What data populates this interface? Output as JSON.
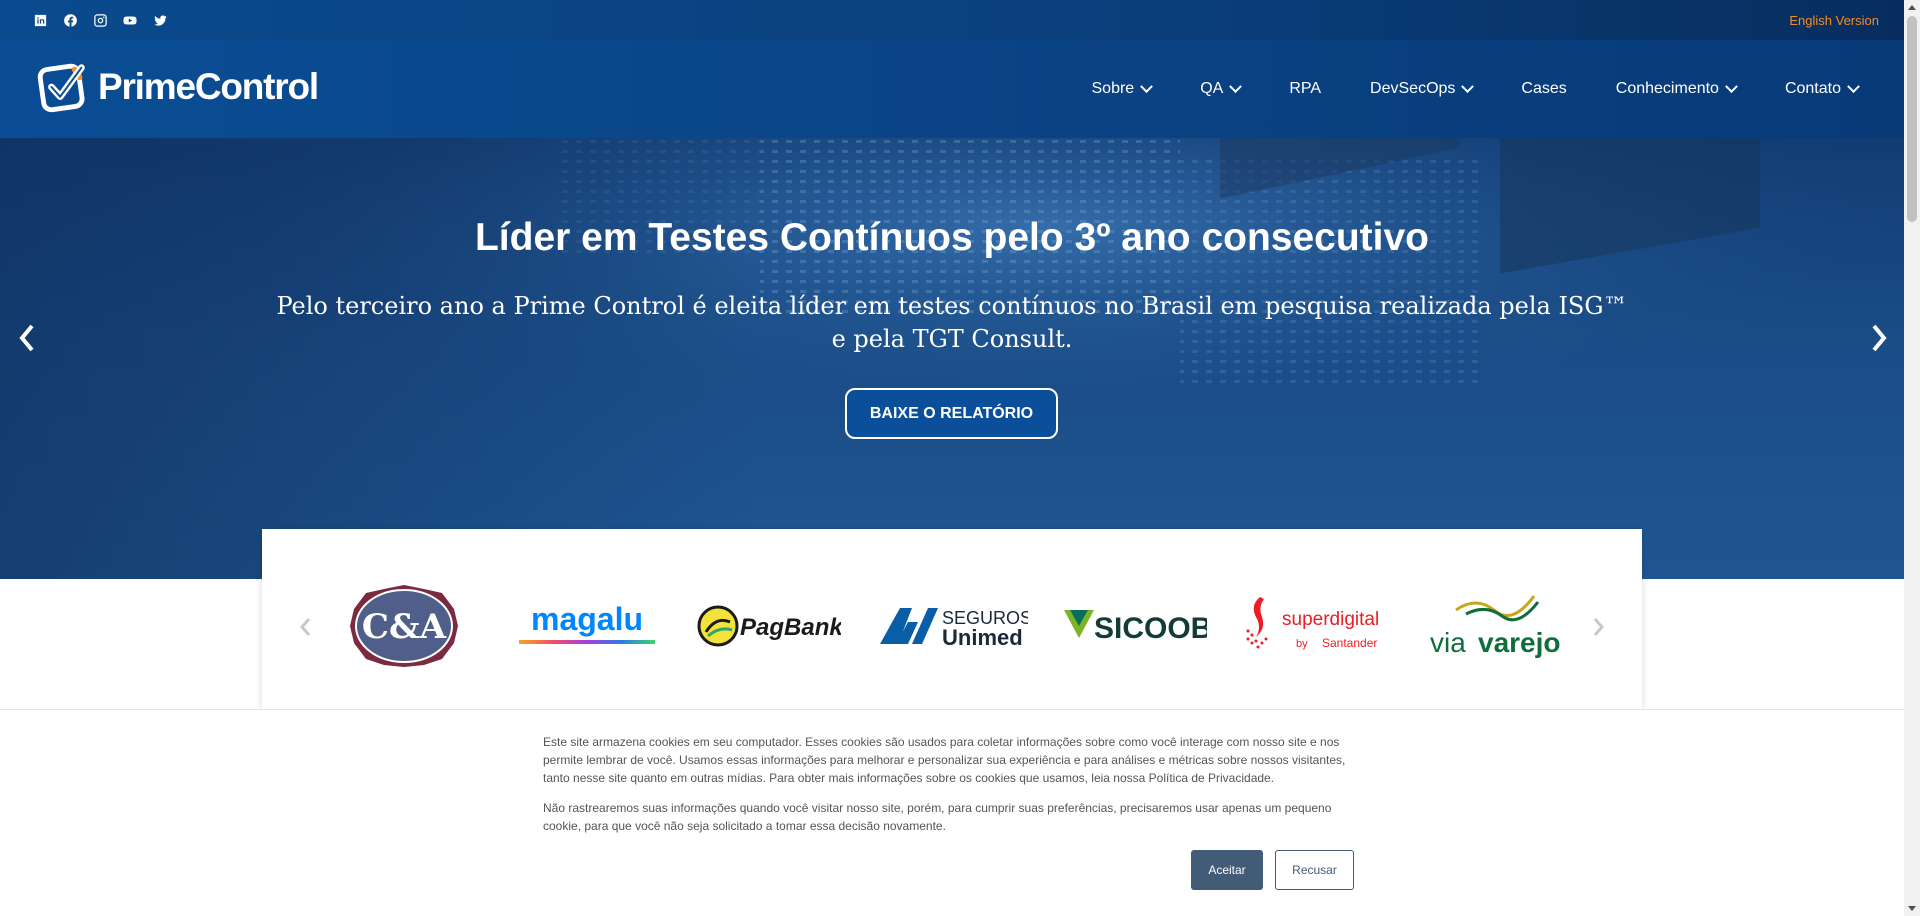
{
  "topbar": {
    "social": [
      "linkedin-icon",
      "facebook-icon",
      "instagram-icon",
      "youtube-icon",
      "twitter-icon"
    ],
    "language_link": "English Version",
    "accent_color": "#f28c28"
  },
  "header": {
    "logo_text": "PrimeControl",
    "nav": [
      {
        "label": "Sobre",
        "dropdown": true
      },
      {
        "label": "QA",
        "dropdown": true
      },
      {
        "label": "RPA",
        "dropdown": false
      },
      {
        "label": "DevSecOps",
        "dropdown": true
      },
      {
        "label": "Cases",
        "dropdown": false
      },
      {
        "label": "Conhecimento",
        "dropdown": true
      },
      {
        "label": "Contato",
        "dropdown": true
      }
    ]
  },
  "hero": {
    "title": "Líder em Testes Contínuos pelo 3º ano consecutivo",
    "subtitle": "Pelo terceiro ano a Prime Control é eleita líder em testes contínuos no Brasil em pesquisa realizada pela ISG™ e pela TGT Consult.",
    "button_label": "BAIXE O RELATÓRIO"
  },
  "brands": {
    "items": [
      {
        "name": "C&A",
        "text": "C&A"
      },
      {
        "name": "Magalu",
        "text": "magalu"
      },
      {
        "name": "PagBank",
        "text": "PagBank"
      },
      {
        "name": "Seguros Unimed",
        "text_top": "SEGUROS",
        "text_bottom": "Unimed"
      },
      {
        "name": "Sicoob",
        "text": "SICOOB"
      },
      {
        "name": "superdigital",
        "text": "superdigital",
        "sub": "by",
        "sub_brand": "Santander"
      },
      {
        "name": "Via Varejo",
        "text_a": "via",
        "text_b": "varejo"
      }
    ]
  },
  "cookie": {
    "paragraph1": "Este site armazena cookies em seu computador. Esses cookies são usados para coletar informações sobre como você interage com nosso site e nos permite lembrar de você. Usamos essas informações para melhorar e personalizar sua experiência e para análises e métricas sobre nossos visitantes, tanto nesse site quanto em outras mídias. Para obter mais informações sobre os cookies que usamos, leia nossa Política de Privacidade.",
    "paragraph2": "Não rastrearemos suas informações quando você visitar nosso site, porém, para cumprir suas preferências, precisaremos usar apenas um pequeno cookie, para que você não seja solicitado a tomar essa decisão novamente.",
    "accept_label": "Aceitar",
    "reject_label": "Recusar"
  }
}
